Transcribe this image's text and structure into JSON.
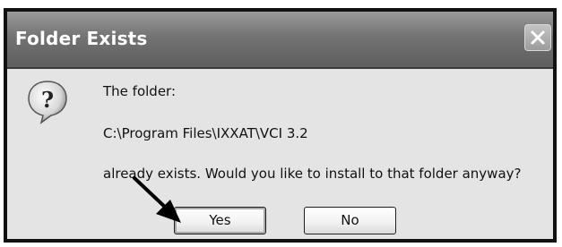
{
  "window": {
    "title": "Folder Exists",
    "close_icon": "close-icon",
    "accent": "#737373"
  },
  "dialog": {
    "icon": "question-icon",
    "line1": "The folder:",
    "path": "C:\\Program Files\\IXXAT\\VCI 3.2",
    "question": "already exists. Would you like to install to that folder anyway?"
  },
  "buttons": {
    "yes_label": "Yes",
    "no_label": "No",
    "default": "Yes"
  },
  "annotation": {
    "icon": "arrow-icon",
    "points_to": "Yes"
  }
}
